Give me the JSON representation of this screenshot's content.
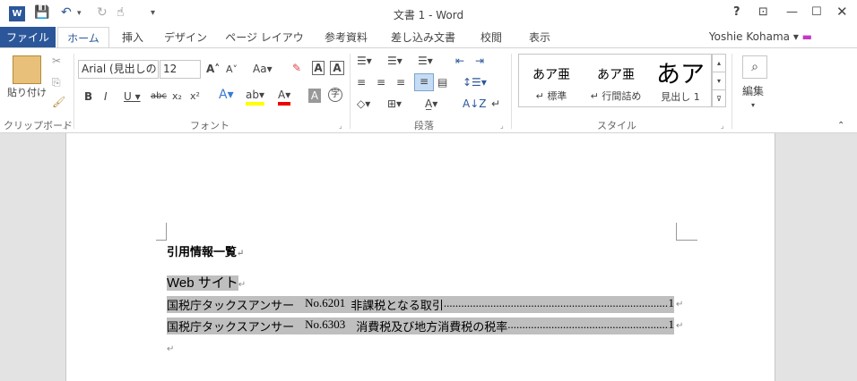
{
  "window": {
    "title": "文書 1 - Word",
    "logo_letter": "W"
  },
  "menu": {
    "file": "ファイル",
    "tabs": [
      "ホーム",
      "挿入",
      "デザイン",
      "ページ レイアウト",
      "参考資料",
      "差し込み文書",
      "校閲",
      "表示"
    ],
    "user": "Yoshie Kohama"
  },
  "ribbon": {
    "clipboard": {
      "paste": "貼り付け",
      "label": "クリップボード"
    },
    "font": {
      "name": "Arial (見出しの",
      "size": "12",
      "label": "フォント"
    },
    "paragraph": {
      "label": "段落"
    },
    "styles": {
      "label": "スタイル",
      "items": [
        {
          "preview": "あア亜",
          "name": "標準"
        },
        {
          "preview": "あア亜",
          "name": "行間詰め"
        },
        {
          "preview": "あア",
          "name": "見出し 1"
        }
      ]
    },
    "edit": {
      "label": "編集"
    }
  },
  "document": {
    "heading": "引用情報一覧",
    "section": "Web サイト",
    "entries": [
      {
        "source": "国税庁タックスアンサー",
        "code": "No.6201",
        "title": "非課税となる取引",
        "page": "1"
      },
      {
        "source": "国税庁タックスアンサー",
        "code": "No.6303",
        "title": "消費税及び地方消費税の税率",
        "page": "1"
      }
    ]
  },
  "colors": {
    "accent": "#2b579a",
    "highlight": "#bfbfbf"
  }
}
